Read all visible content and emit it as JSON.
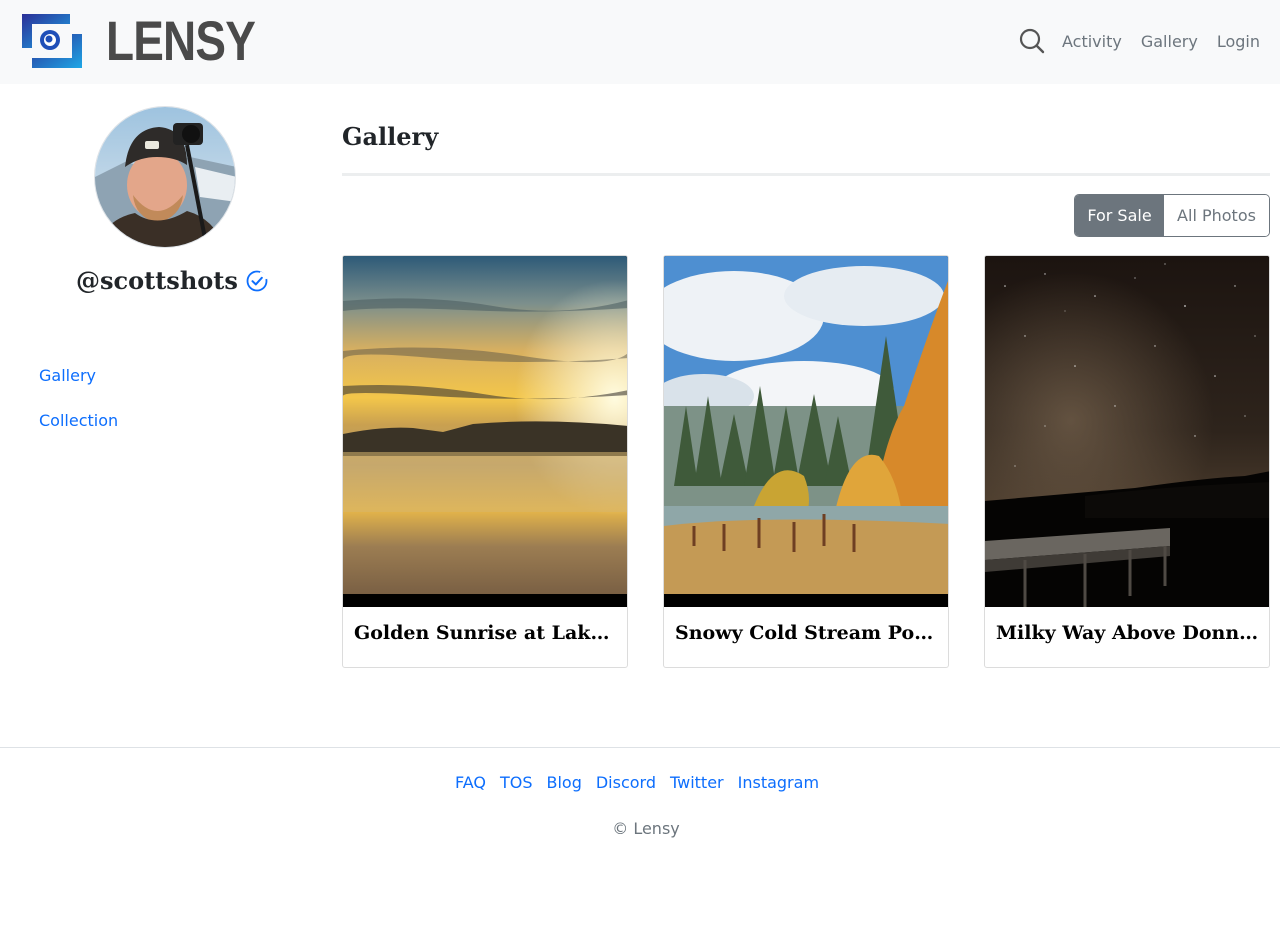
{
  "header": {
    "brand": "LENSY",
    "nav": [
      "Activity",
      "Gallery",
      "Login"
    ],
    "search_icon": "search-icon",
    "logo_colors": [
      "#2b3a9e",
      "#1f9bdf"
    ]
  },
  "profile": {
    "handle": "@scottshots",
    "verified_icon": "verified-check-icon",
    "sidebar_links": [
      "Gallery",
      "Collection"
    ]
  },
  "main": {
    "title": "Gallery",
    "filter": {
      "active": "For Sale",
      "inactive": "All Photos"
    },
    "photos": [
      {
        "caption": "Golden Sunrise at Lake T..."
      },
      {
        "caption": "Snowy Cold Stream Pon..."
      },
      {
        "caption": "Milky Way Above Donne..."
      }
    ]
  },
  "footer": {
    "links": [
      "FAQ",
      "TOS",
      "Blog",
      "Discord",
      "Twitter",
      "Instagram"
    ],
    "copyright": "© Lensy"
  },
  "colors": {
    "accent": "#0d6efd",
    "muted": "#6c757d",
    "header_bg": "#f8f9fa"
  }
}
